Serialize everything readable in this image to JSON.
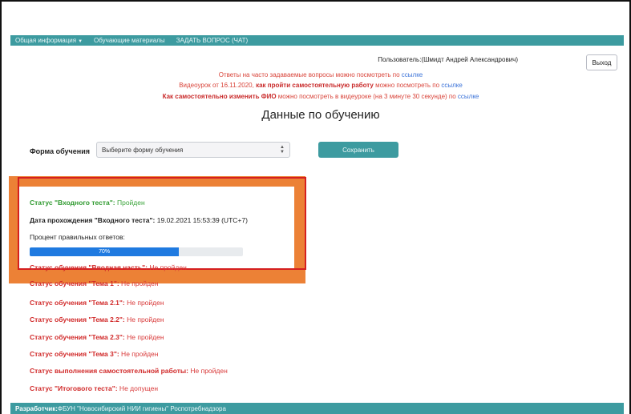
{
  "navbar": {
    "items": [
      {
        "label": "Общая информация"
      },
      {
        "label": "Обучающие материалы"
      },
      {
        "label": "ЗАДАТЬ ВОПРОС (ЧАТ)"
      }
    ]
  },
  "header": {
    "user_text": "Пользователь:(Шмидт Андрей Александрович)",
    "logout_label": "Выход"
  },
  "notices": {
    "n1_text": "Ответы на часто задаваемые вопросы можно посмотреть по ",
    "n1_link": "ссылке",
    "n2_prefix": "Видеоурок от 16.11.2020, ",
    "n2_bold": "как пройти самостоятельную работу",
    "n2_mid": " можно посмотреть по ",
    "n2_link": "ссылке",
    "n3_bold": "Как самостоятельно изменить ФИО",
    "n3_mid": " можно посмотреть в видеуроке (на 3 минуте 30 секунде) по ",
    "n3_link": "ссылке"
  },
  "main": {
    "title": "Данные по обучению",
    "form_label": "Форма обучения",
    "select_value": "Выберите форму обучения",
    "save_label": "Сохранить"
  },
  "status": {
    "entry_test_label": "Статус \"Входного теста\":",
    "entry_test_value": " Пройден",
    "date_label": "Дата прохождения \"Входного теста\":",
    "date_value": " 19.02.2021 15:53:39 (UTC+7)",
    "percent_label": "Процент правильных ответов:",
    "percent_text": "70%",
    "percent_value": 70,
    "items": [
      {
        "label": "Статус обучения \"Вводная часть\":",
        "value": " Не пройден"
      },
      {
        "label": "Статус обучения \"Тема 1\":",
        "value": " Не пройден"
      },
      {
        "label": "Статус обучения \"Тема 2.1\":",
        "value": " Не пройден"
      },
      {
        "label": "Статус обучения \"Тема 2.2\":",
        "value": " Не пройден"
      },
      {
        "label": "Статус обучения \"Тема 2.3\":",
        "value": " Не пройден"
      },
      {
        "label": "Статус обучения \"Тема 3\":",
        "value": " Не пройден"
      },
      {
        "label": "Статус выполнения самостоятельной работы:",
        "value": " Не пройден"
      },
      {
        "label": "Статус \"Итогового теста\":",
        "value": " Не допущен"
      }
    ]
  },
  "footer": {
    "label": "Разработчик:",
    "value": " ФБУН \"Новосибирский НИИ гигиены\" Роспотребнадзора"
  },
  "colors": {
    "teal": "#3d9ba0",
    "orange_highlight": "#ec8136",
    "red_outline": "#d51f1f",
    "pass_green": "#3aa43a",
    "fail_red": "#d93a3a",
    "progress_blue": "#1f7ae0"
  }
}
